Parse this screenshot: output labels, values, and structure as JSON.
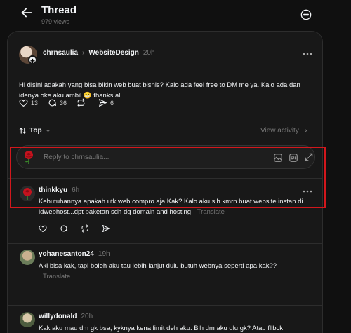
{
  "header": {
    "title": "Thread",
    "views": "979 views"
  },
  "post": {
    "username": "chrnsaulia",
    "separator": "›",
    "community": "WebsiteDesign",
    "time": "20h",
    "text": "Hi disini adakah yang bisa bikin web buat bisnis? Kalo ada feel free to DM me ya. Kalo ada dan idenya oke aku ambil 😁 thanks all",
    "likes": "13",
    "comments": "36",
    "reposts": "",
    "shares": "6"
  },
  "sort": {
    "label": "Top",
    "view_activity": "View activity"
  },
  "reply": {
    "placeholder": "Reply to chrnsaulia..."
  },
  "comments": [
    {
      "username": "thinkkyu",
      "time": "6h",
      "text": "Kebutuhannya apakah utk web compro aja Kak? Kalo aku sih kmrn buat website instan di idwebhost...dpt paketan sdh dg domain and hosting.",
      "translate": "Translate"
    },
    {
      "username": "yohanesanton24",
      "time": "19h",
      "text": "Aki bisa kak, tapi boleh aku tau lebih lanjut dulu butuh webnya seperti apa kak??",
      "translate": "Translate"
    },
    {
      "username": "willydonald",
      "time": "20h",
      "text": "Kak aku mau dm gk bsa, kyknya kena limit deh aku. Blh dm aku dlu gk? Atau fllbck"
    }
  ],
  "colors": {
    "background": "#101010",
    "card": "#181818",
    "highlight": "#d2171c",
    "muted": "#777777"
  }
}
